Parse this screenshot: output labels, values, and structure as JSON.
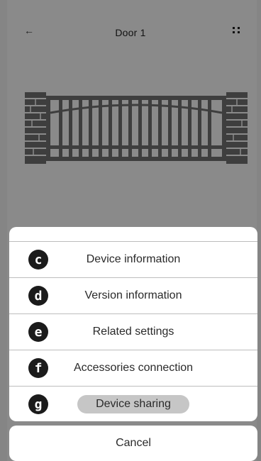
{
  "header": {
    "title": "Door 1",
    "back_icon": "←"
  },
  "menu": {
    "items": [
      {
        "badge": "c",
        "label": "Device information"
      },
      {
        "badge": "d",
        "label": "Version information"
      },
      {
        "badge": "e",
        "label": "Related settings"
      },
      {
        "badge": "f",
        "label": "Accessories connection"
      },
      {
        "badge": "g",
        "label": "Device sharing"
      }
    ],
    "cancel_label": "Cancel"
  },
  "colors": {
    "backdrop": "#8a8a8a",
    "sheet": "#ffffff",
    "badge": "#1b1b1b",
    "highlight": "#c6c6c6"
  }
}
